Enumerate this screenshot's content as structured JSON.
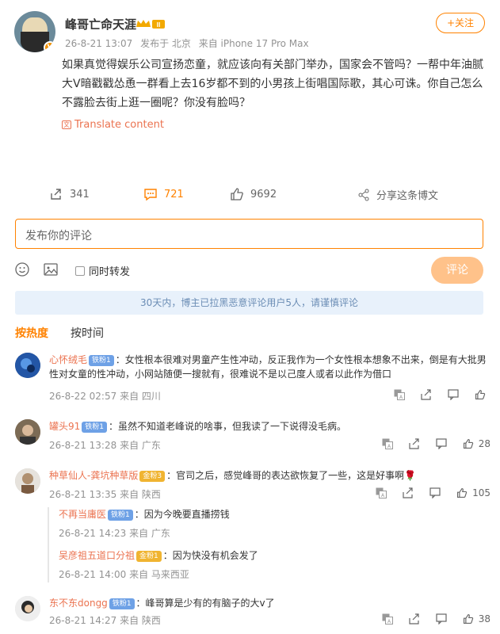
{
  "post": {
    "author": "峰哥亡命天涯",
    "verified_badge": "V",
    "time": "26-8-21 13:07",
    "location": "发布于 北京",
    "source": "来自 iPhone 17 Pro Max",
    "follow_label": "+关注",
    "text": "如果真觉得娱乐公司宣扬恋童，就应该向有关部门举办，国家会不管吗？一帮中年油腻大V暗戳戳怂恿一群看上去16岁都不到的小男孩上街唱国际歌，其心可诛。你自己怎么不露脸去街上逛一圈呢？你没有脸吗？",
    "translate_label": "Translate content",
    "translate_icon": "文",
    "reposts": "341",
    "comments": "721",
    "likes": "9692",
    "share_label": "分享这条博文"
  },
  "composer": {
    "placeholder": "发布你的评论",
    "repost_label": "同时转发",
    "submit_label": "评论"
  },
  "notice": "30天内，博主已拉黑恶意评论用户5人，请谨慎评论",
  "sort": {
    "hot": "按热度",
    "time": "按时间"
  },
  "comments": [
    {
      "name": "心怀绒毛",
      "level": "铁粉1",
      "text": "：女性根本很难对男童产生性冲动，反正我作为一个女性根本想象不出来，倒是有大批男性对女童的性冲动，小网站随便一搜就有，很难说不是以己度人或者以此作为借口",
      "time": "26-8-22 02:57",
      "loc": "来自 四川",
      "likes": ""
    },
    {
      "name": "罐头91",
      "level": "铁粉1",
      "text": "：虽然不知道老峰说的啥事，但我读了一下说得没毛病。",
      "time": "26-8-21 13:28",
      "loc": "来自 广东",
      "likes": "28"
    },
    {
      "name": "种草仙人-龚坑种草版",
      "level": "金粉3",
      "text": "：官司之后，感觉峰哥的表达欲恢复了一些，这是好事啊🌹",
      "time": "26-8-21 13:35",
      "loc": "来自 陕西",
      "likes": "105"
    },
    {
      "name": "东不东dongg",
      "level": "铁粉1",
      "text": "：峰哥算是少有的有脑子的大v了",
      "time": "26-8-21 14:27",
      "loc": "来自 陕西",
      "likes": "38"
    }
  ],
  "replies": [
    {
      "name": "不再当庸医",
      "level": "铁粉1",
      "text": "：因为今晚要直播捞钱",
      "time": "26-8-21 14:23",
      "loc": "来自 广东"
    },
    {
      "name": "吴彦祖五道口分祖",
      "level": "金粉1",
      "text": "：因为快没有机会发了",
      "time": "26-8-21 14:00",
      "loc": "来自 马来西亚"
    }
  ]
}
